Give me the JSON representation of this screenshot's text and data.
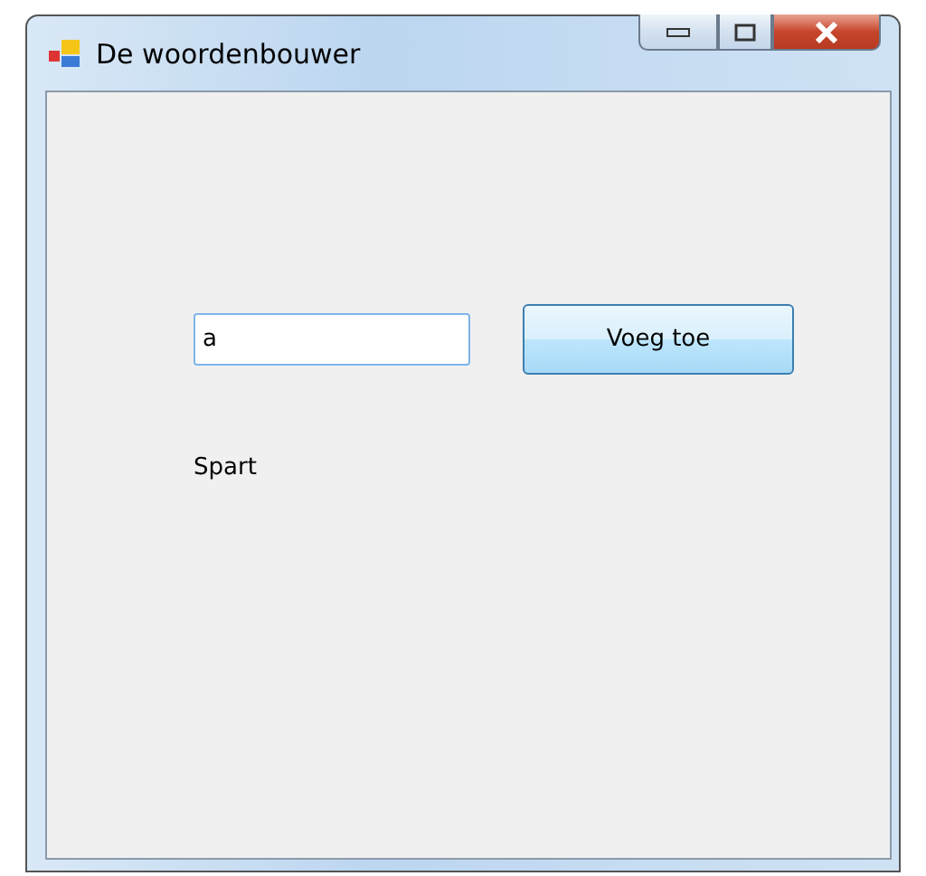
{
  "window": {
    "title": "De woordenbouwer"
  },
  "input": {
    "value": "a",
    "focused": true
  },
  "button": {
    "label": "Voeg toe"
  },
  "label": {
    "text": "Spart"
  }
}
